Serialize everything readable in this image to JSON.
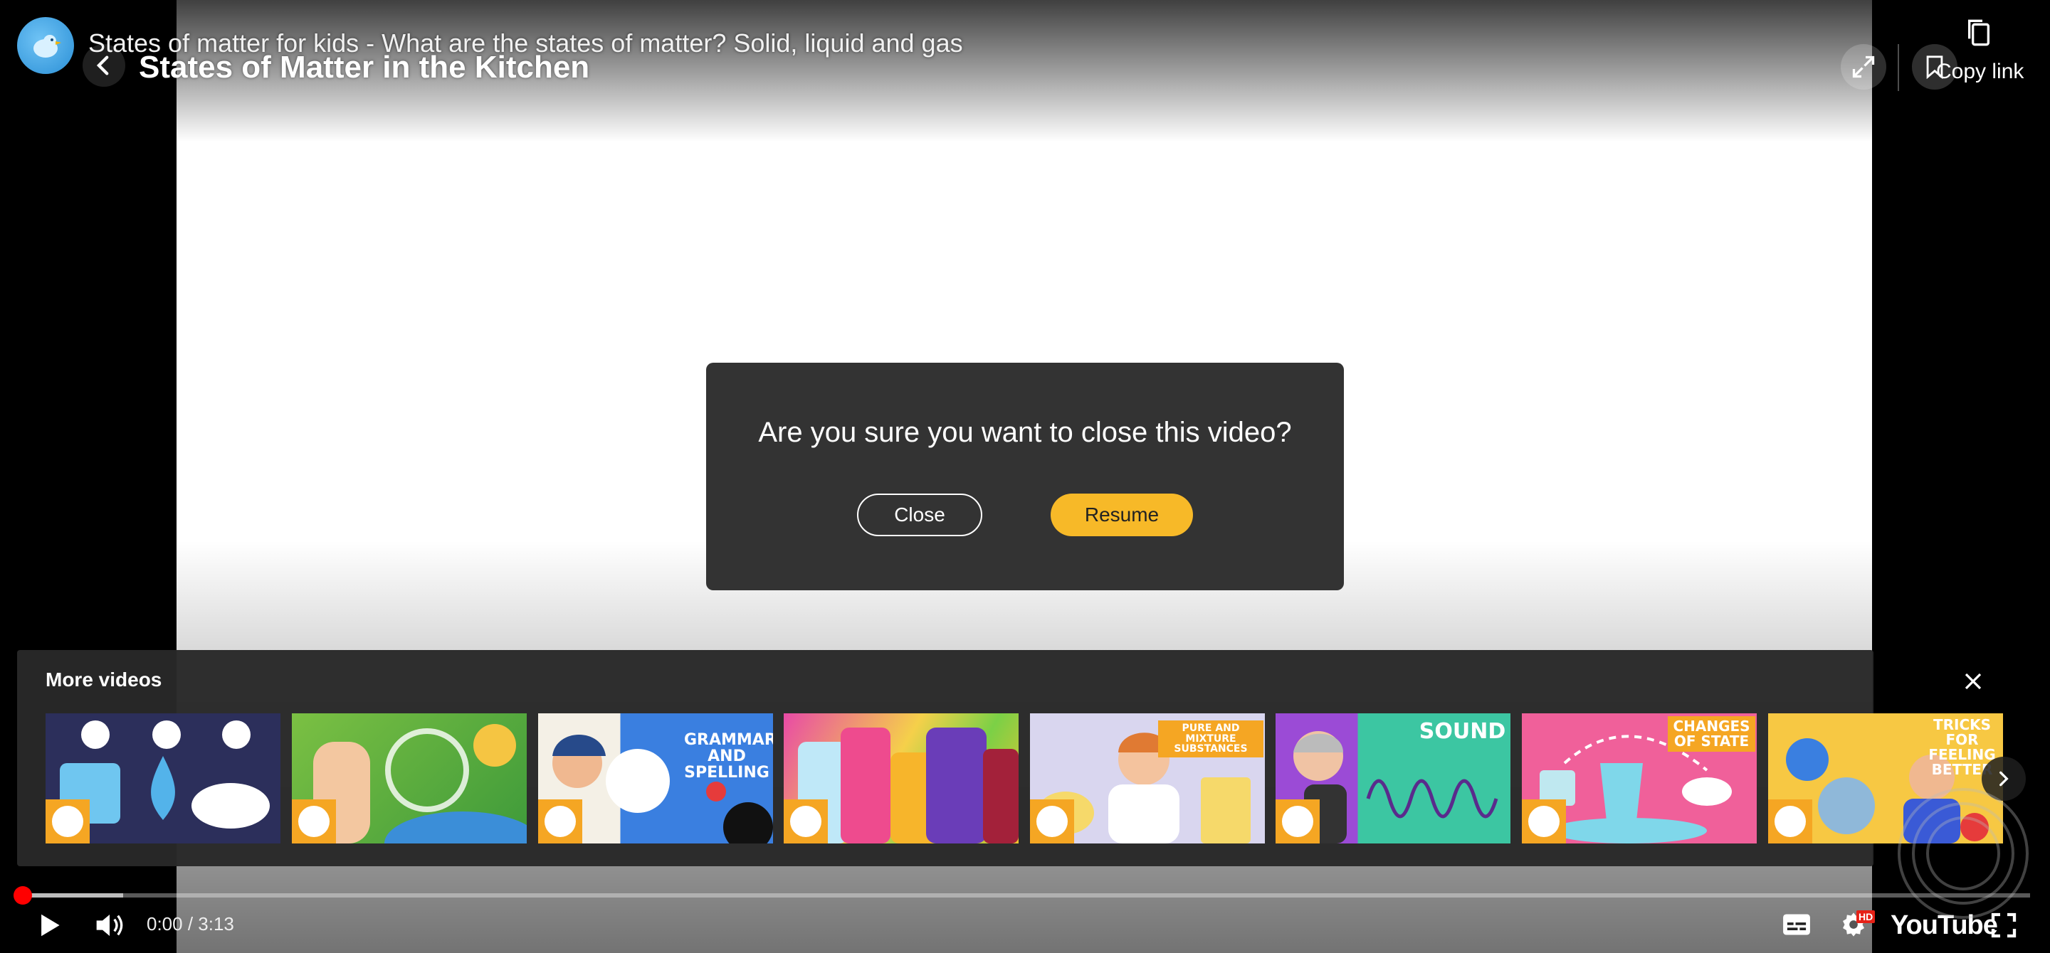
{
  "header": {
    "youtube_title": "States of matter for kids - What are the states of matter? Solid, liquid and gas",
    "page_title": "States of Matter in the Kitchen",
    "copy_link_label": "Copy link"
  },
  "dialog": {
    "question": "Are you sure you want to close this video?",
    "close_label": "Close",
    "resume_label": "Resume",
    "resume_color": "#f7b928"
  },
  "more_videos": {
    "title": "More videos",
    "items": [
      {
        "name": "states-of-matter",
        "text": ""
      },
      {
        "name": "recycling",
        "text": ""
      },
      {
        "name": "grammar-and-spelling",
        "text": "GRAMMAR AND SPELLING"
      },
      {
        "name": "characters",
        "text": ""
      },
      {
        "name": "pure-and-mixture-substances",
        "text": "PURE AND MIXTURE SUBSTANCES"
      },
      {
        "name": "sound",
        "text": "SOUND"
      },
      {
        "name": "changes-of-state",
        "text": "CHANGES OF STATE"
      },
      {
        "name": "tricks-for-feeling-better",
        "text": "TRICKS FOR FEELING BETTER"
      }
    ]
  },
  "player": {
    "time": "0:00 / 3:13",
    "logo": "YouTube",
    "hd": "HD",
    "progress_fraction": 0,
    "buffered_fraction": 0.05
  }
}
